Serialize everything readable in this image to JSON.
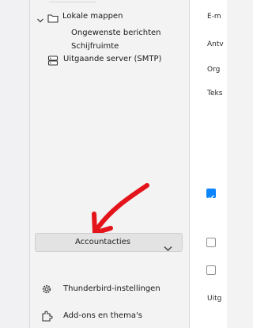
{
  "folder_tree": {
    "local_folders_label": "Lokale mappen",
    "junk_label": "Ongewenste berichten",
    "trash_label": "Schijfruimte",
    "outgoing_server_label": "Uitgaande server (SMTP)"
  },
  "account_actions": {
    "label": "Accountacties"
  },
  "footer": {
    "settings_label": "Thunderbird-instellingen",
    "addons_label": "Add-ons en thema's"
  },
  "right_pane": {
    "labels": [
      "E-m",
      "Antv",
      "Org",
      "Teks",
      "Uitg"
    ],
    "checkbox_states": [
      true,
      false,
      false
    ]
  },
  "colors": {
    "accent": "#0a84ff",
    "arrow": "#e4141b"
  },
  "icons": [
    "chevron-down-icon",
    "folder-icon",
    "server-icon",
    "gear-icon",
    "puzzle-icon",
    "red-arrow"
  ]
}
